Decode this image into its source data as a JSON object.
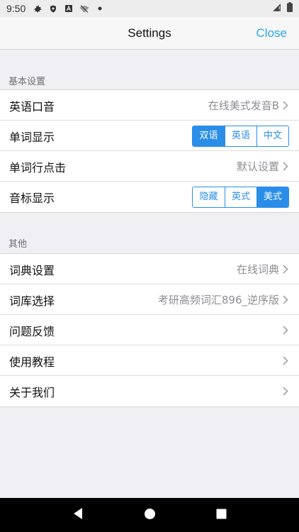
{
  "status": {
    "time": "9:50",
    "icons": [
      "gear-icon",
      "shield-icon",
      "a-icon",
      "wifi-off-icon",
      "dot-icon"
    ],
    "right_icons": [
      "signal-icon",
      "battery-icon"
    ]
  },
  "nav": {
    "title": "Settings",
    "close_label": "Close"
  },
  "sections": {
    "basic": {
      "header": "基本设置",
      "rows": {
        "accent": {
          "label": "英语口音",
          "value": "在线美式发音B"
        },
        "word_display": {
          "label": "单词显示",
          "options": [
            "双语",
            "英语",
            "中文"
          ],
          "selected": "双语"
        },
        "row_click": {
          "label": "单词行点击",
          "value": "默认设置"
        },
        "phonetic": {
          "label": "音标显示",
          "options": [
            "隐藏",
            "英式",
            "美式"
          ],
          "selected": "美式"
        }
      }
    },
    "other": {
      "header": "其他",
      "rows": {
        "dictionary": {
          "label": "词典设置",
          "value": "在线词典"
        },
        "wordbank": {
          "label": "词库选择",
          "value": "考研高频词汇896_逆序版"
        },
        "feedback": {
          "label": "问题反馈"
        },
        "tutorial": {
          "label": "使用教程"
        },
        "about": {
          "label": "关于我们"
        }
      }
    }
  },
  "colors": {
    "accent": "#2a8ee8",
    "link": "#2aa6e8",
    "background": "#efeff4"
  },
  "system_nav": {
    "icons": [
      "back-icon",
      "home-icon",
      "recents-icon"
    ]
  }
}
